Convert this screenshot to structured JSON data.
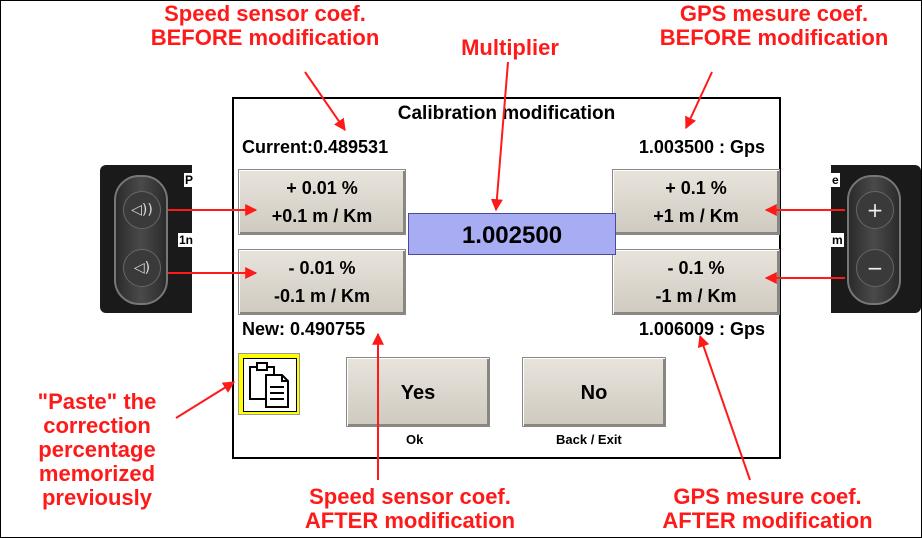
{
  "annotations": {
    "speed_before": [
      "Speed sensor coef.",
      "BEFORE modification"
    ],
    "multiplier": "Multiplier",
    "gps_before": [
      "GPS mesure coef.",
      "BEFORE modification"
    ],
    "paste": [
      "\"Paste\" the",
      "correction",
      "percentage",
      "memorized",
      "previously"
    ],
    "speed_after": [
      "Speed sensor coef.",
      "AFTER modification"
    ],
    "gps_after": [
      "GPS mesure coef.",
      "AFTER modification"
    ]
  },
  "dialog": {
    "title": "Calibration modification",
    "current": "Current:0.489531",
    "gps_current": "1.003500 : Gps",
    "new": "New: 0.490755",
    "gps_new": "1.006009 : Gps",
    "multiplier_value": "1.002500",
    "buttons": {
      "plus_small": [
        "+ 0.01 %",
        "+0.1 m / Km"
      ],
      "minus_small": [
        "- 0.01 %",
        "-0.1 m / Km"
      ],
      "plus_large": [
        "+ 0.1 %",
        "+1 m / Km"
      ],
      "minus_large": [
        "- 0.1 %",
        "-1 m / Km"
      ],
      "yes": "Yes",
      "yes_sub": "Ok",
      "no": "No",
      "no_sub": "Back / Exit"
    }
  },
  "device_left": {
    "edge_top": "P",
    "edge_mid": "1n",
    "up_icon": "volume-up-icon",
    "down_icon": "volume-down-icon",
    "up_glyph": "◁))",
    "down_glyph": "◁)"
  },
  "device_right": {
    "edge_top": "e",
    "edge_mid": "m",
    "plus": "+",
    "minus": "−"
  },
  "colors": {
    "annotation": "#ff1a1a",
    "multiplier_bg": "#a7acf3",
    "paste_bg": "#ffff00",
    "button_bg": "#dcd8d0"
  }
}
